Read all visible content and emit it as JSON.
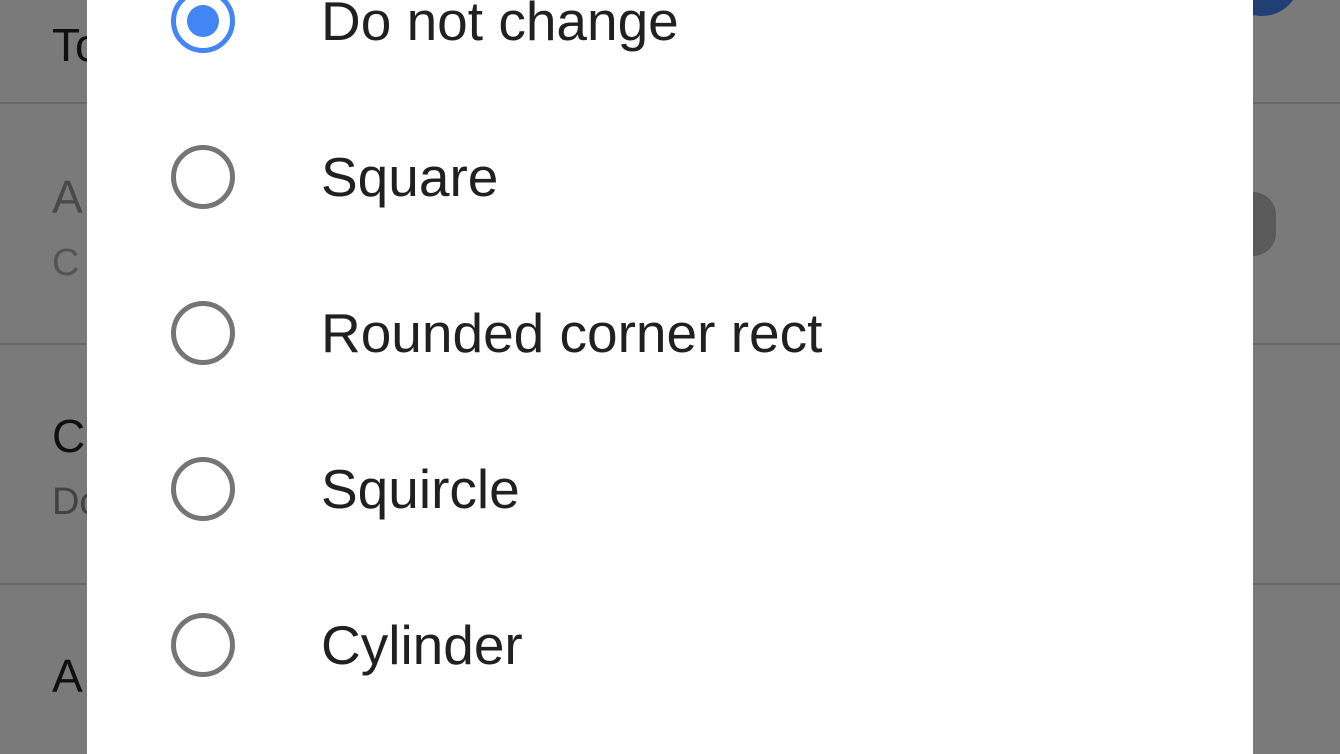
{
  "background": {
    "rows": [
      {
        "title": "To",
        "subtitle": ""
      },
      {
        "title": "A",
        "subtitle": "C"
      },
      {
        "title": "C",
        "subtitle": "Do"
      },
      {
        "title": "A",
        "subtitle": ""
      }
    ]
  },
  "dialog": {
    "options": [
      {
        "label": "Do not change",
        "selected": true
      },
      {
        "label": "Square",
        "selected": false
      },
      {
        "label": "Rounded corner rect",
        "selected": false
      },
      {
        "label": "Squircle",
        "selected": false
      },
      {
        "label": "Cylinder",
        "selected": false
      }
    ]
  },
  "colors": {
    "accent": "#4285f4",
    "radio_unchecked": "#757575",
    "text": "#202020"
  }
}
